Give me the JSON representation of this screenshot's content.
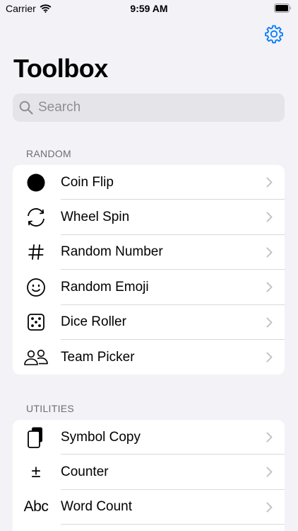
{
  "status": {
    "carrier": "Carrier",
    "time": "9:59 AM"
  },
  "header": {
    "title": "Toolbox"
  },
  "search": {
    "placeholder": "Search"
  },
  "sections": [
    {
      "header": "RANDOM",
      "items": [
        {
          "label": "Coin Flip",
          "icon": "coin-icon"
        },
        {
          "label": "Wheel Spin",
          "icon": "wheel-spin-icon"
        },
        {
          "label": "Random Number",
          "icon": "number-sign-icon"
        },
        {
          "label": "Random Emoji",
          "icon": "smiley-icon"
        },
        {
          "label": "Dice Roller",
          "icon": "dice-icon"
        },
        {
          "label": "Team Picker",
          "icon": "people-icon"
        }
      ]
    },
    {
      "header": "UTILITIES",
      "items": [
        {
          "label": "Symbol Copy",
          "icon": "copy-icon"
        },
        {
          "label": "Counter",
          "icon": "plus-minus-icon",
          "glyph": "±"
        },
        {
          "label": "Word Count",
          "icon": "abc-icon",
          "glyph": "Abc"
        }
      ]
    }
  ],
  "colors": {
    "accent": "#007aff",
    "background": "#f2f2f7",
    "chevron": "#c4c4c7"
  }
}
